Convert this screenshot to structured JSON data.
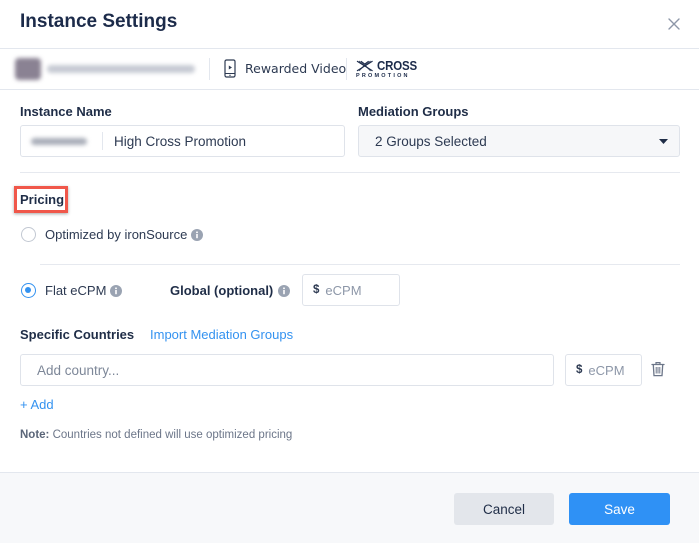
{
  "header": {
    "title": "Instance Settings",
    "close_icon": "close-icon"
  },
  "subheader": {
    "app_name": "",
    "ad_unit_icon": "phone-video-icon",
    "ad_unit": "Rewarded Video",
    "network_logo": {
      "word1": "CROSS",
      "word2": "PROMOTION"
    }
  },
  "form": {
    "instance_name": {
      "label": "Instance Name",
      "value": "High Cross Promotion"
    },
    "mediation_groups": {
      "label": "Mediation Groups",
      "selected": "2 Groups Selected"
    },
    "pricing": {
      "label": "Pricing",
      "highlighted": true,
      "options": [
        {
          "label": "Optimized by ironSource",
          "selected": false,
          "has_info": true
        },
        {
          "label": "Flat eCPM",
          "selected": true,
          "has_info": true
        }
      ],
      "global": {
        "label": "Global (optional)",
        "currency": "$",
        "placeholder": "eCPM",
        "value": ""
      }
    },
    "specific_countries": {
      "label": "Specific Countries",
      "import_link": "Import Mediation Groups",
      "country_placeholder": "Add country...",
      "country_value": "",
      "currency": "$",
      "ecpm_placeholder": "eCPM",
      "ecpm_value": "",
      "add_link": "+ Add",
      "note_label": "Note:",
      "note_text": " Countries not defined will use optimized pricing"
    }
  },
  "footer": {
    "cancel_label": "Cancel",
    "save_label": "Save"
  },
  "colors": {
    "accent": "#3392f0",
    "primary_button": "#2f91f5",
    "highlight_border": "#f0574a",
    "title_text": "#1c2b4a"
  }
}
